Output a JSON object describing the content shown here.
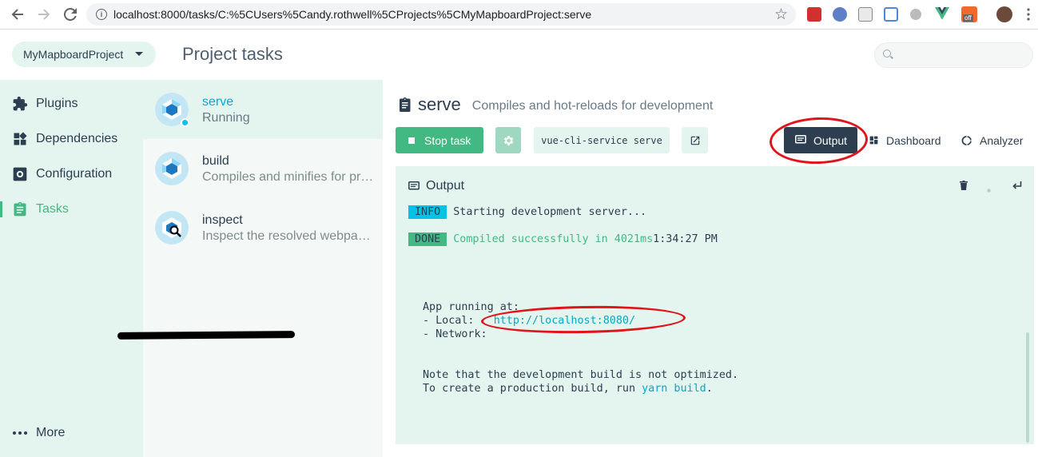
{
  "browser": {
    "url": "localhost:8000/tasks/C:%5CUsers%5Candy.rothwell%5CProjects%5CMyMapboardProject:serve",
    "back_icon": "back-arrow-icon",
    "forward_icon": "forward-arrow-icon",
    "reload_icon": "reload-icon",
    "ext_badge": "off"
  },
  "header": {
    "project": "MyMapboardProject",
    "title": "Project tasks",
    "search_placeholder": ""
  },
  "sidebar": {
    "items": [
      {
        "label": "Plugins",
        "icon": "puzzle-icon"
      },
      {
        "label": "Dependencies",
        "icon": "widgets-icon"
      },
      {
        "label": "Configuration",
        "icon": "settings-icon"
      },
      {
        "label": "Tasks",
        "icon": "clipboard-icon"
      }
    ],
    "more": "More"
  },
  "tasks": [
    {
      "name": "serve",
      "desc": "Running"
    },
    {
      "name": "build",
      "desc": "Compiles and minifies for production"
    },
    {
      "name": "inspect",
      "desc": "Inspect the resolved webpack config"
    }
  ],
  "main": {
    "task_name": "serve",
    "task_desc": "Compiles and hot-reloads for development",
    "stop_label": "Stop task",
    "command": "vue-cli-service serve",
    "tabs": {
      "output": "Output",
      "dashboard": "Dashboard",
      "analyzer": "Analyzer"
    }
  },
  "output": {
    "title": "Output",
    "info_tag": "INFO",
    "info_msg": "Starting development server...",
    "done_tag": "DONE",
    "done_msg": "Compiled successfully in 4021ms",
    "done_time": "1:34:27 PM",
    "line_running": "App running at:",
    "local_prefix": "- Local:   ",
    "local_url": "http://localhost:8080/",
    "network_prefix": "- Network: ",
    "note1": "Note that the development build is not optimized.",
    "note2_prefix": "To create a production build, run ",
    "note2_cmd": "yarn build",
    "note2_suffix": "."
  },
  "colors": {
    "accent": "#42b983",
    "dark": "#2c3e50",
    "info": "#03c2e6",
    "annotation": "#e0151b"
  }
}
